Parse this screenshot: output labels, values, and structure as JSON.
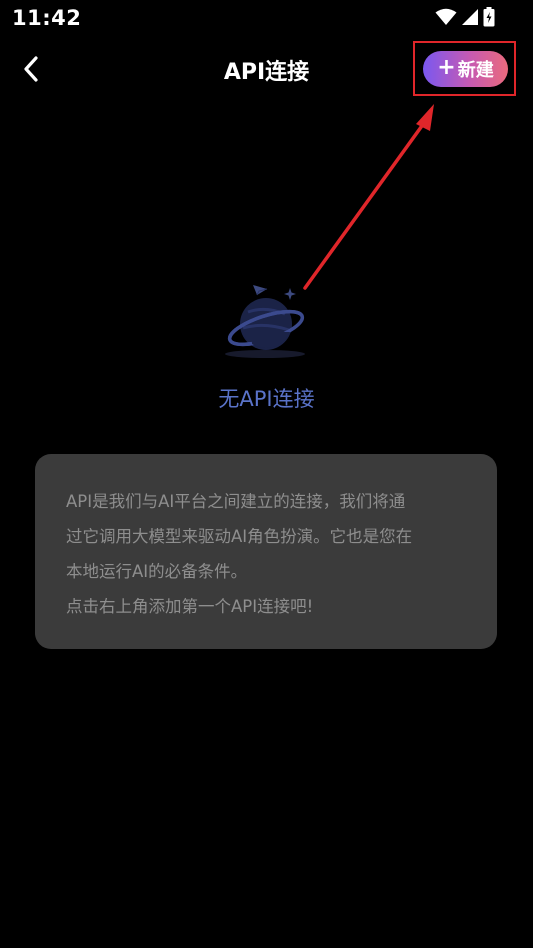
{
  "status_bar": {
    "time": "11:42",
    "icons": [
      "wifi-icon",
      "signal-icon",
      "battery-icon"
    ]
  },
  "header": {
    "back_icon": "chevron-left-icon",
    "title": "API连接",
    "new_button": {
      "plus": "+",
      "label": "新建"
    }
  },
  "empty_state": {
    "icon": "planet-icon",
    "title": "无API连接"
  },
  "info_card": {
    "lines": [
      "API是我们与AI平台之间建立的连接，我们将通",
      "过它调用大模型来驱动AI角色扮演。它也是您在",
      "本地运行AI的必备条件。",
      "点击右上角添加第一个API连接吧!"
    ]
  },
  "colors": {
    "background": "#000000",
    "accent_start": "#7a58f0",
    "accent_end": "#ea6a7d",
    "empty_title": "#5a73c9",
    "card_background": "#3b3b3b",
    "card_text": "#8e8e8e",
    "annotation": "#e0262a"
  }
}
